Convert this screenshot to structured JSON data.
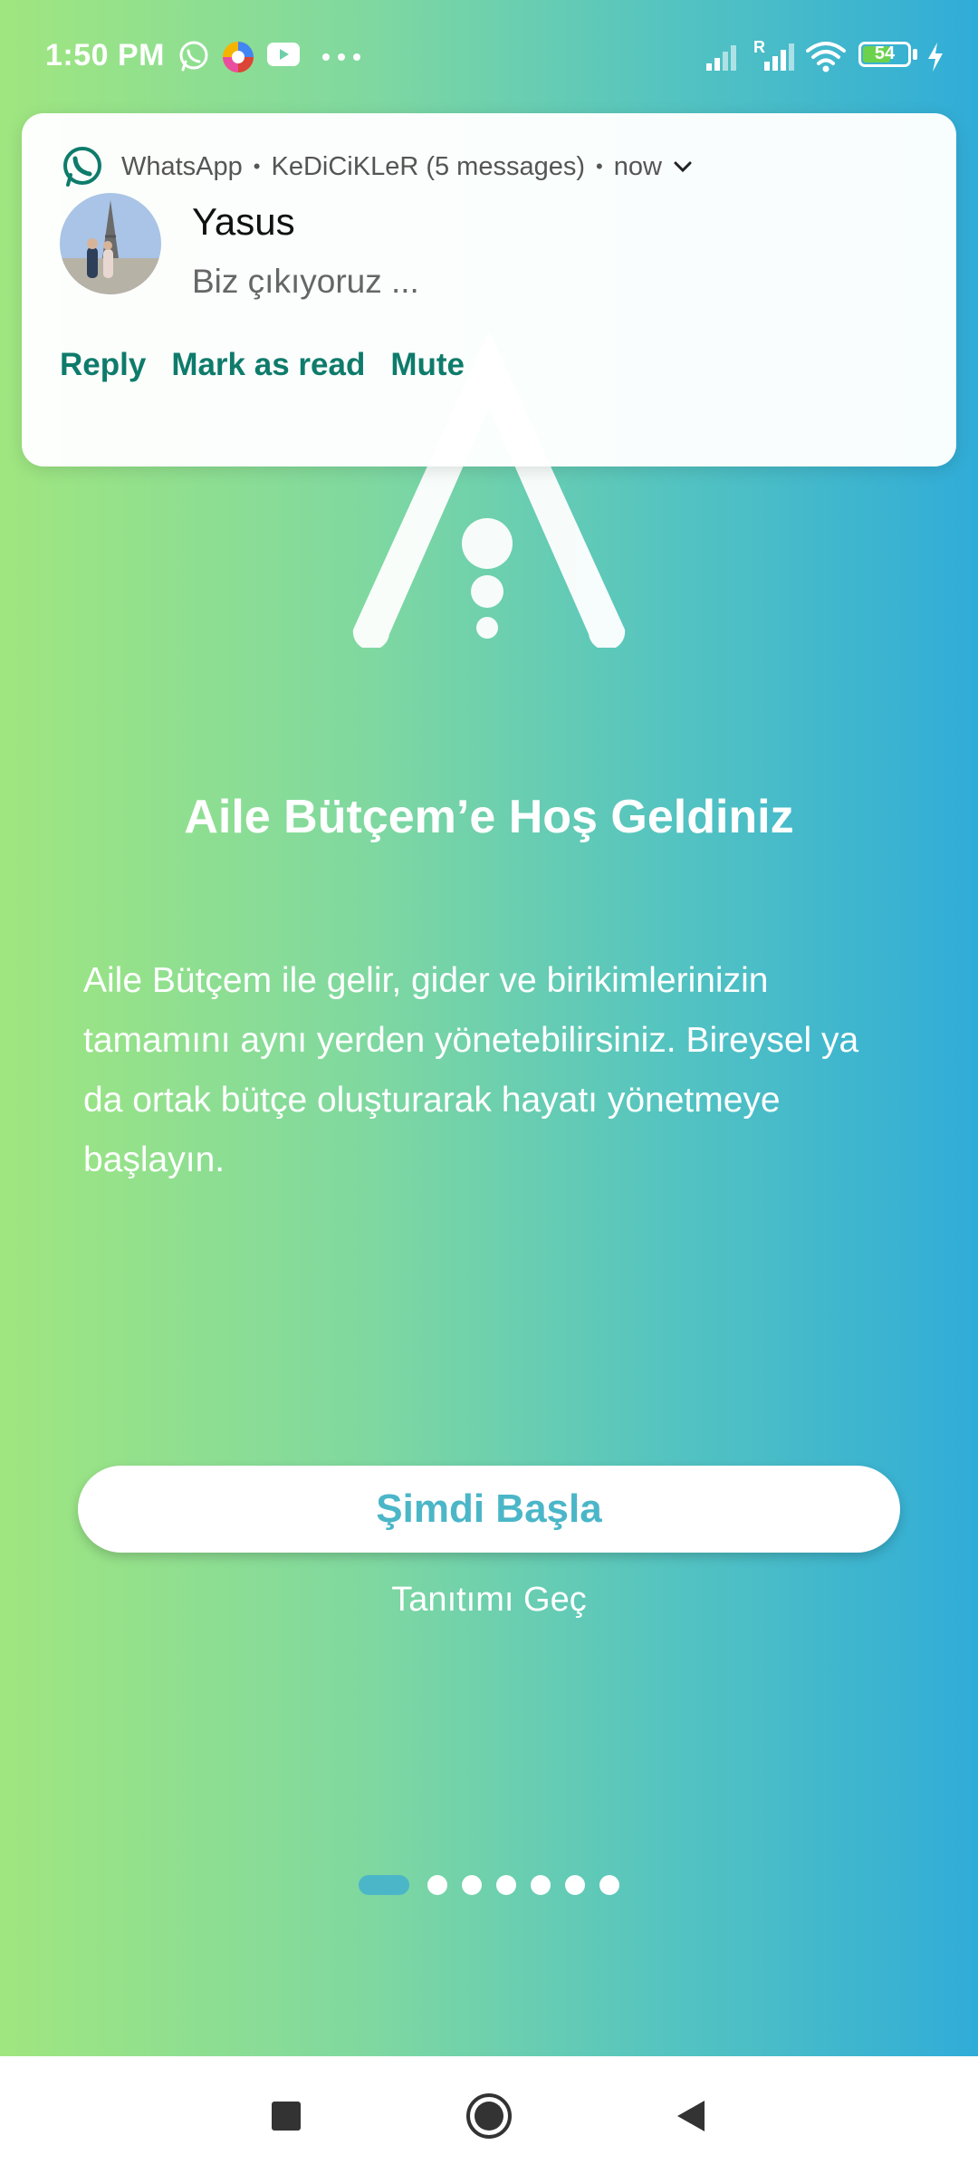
{
  "status_bar": {
    "time": "1:50 PM",
    "battery": "54",
    "roaming": "R",
    "left_icons": [
      "whatsapp-icon",
      "browser-icon",
      "youtube-icon",
      "more-dots-icon"
    ],
    "right_icons": [
      "signal-icon",
      "signal-roaming-icon",
      "wifi-icon",
      "battery-icon",
      "charging-icon"
    ]
  },
  "notification": {
    "app": "WhatsApp",
    "group": "KeDiCiKLeR (5 messages)",
    "time": "now",
    "sender": "Yasus",
    "message": "Biz çıkıyoruz ...",
    "actions": {
      "reply": "Reply",
      "mark_read": "Mark as read",
      "mute": "Mute"
    }
  },
  "onboarding": {
    "title": "Aile Bütçem’e Hoş Geldiniz",
    "description": "Aile Bütçem ile gelir, gider ve birikimlerinizin tamamını aynı yerden yönetebilirsiniz. Bireysel ya da ortak bütçe oluşturarak hayatı yönetmeye başlayın.",
    "start_button": "Şimdi Başla",
    "skip_link": "Tanıtımı Geç",
    "page_count": 7,
    "current_page": 1
  },
  "colors": {
    "gradient_left": "#a0e680",
    "gradient_right": "#30acd8",
    "accent": "#4bb6c8",
    "whatsapp_green": "#0e7b6b"
  },
  "nav_bar": {
    "icons": [
      "recents-square-icon",
      "home-circle-icon",
      "back-triangle-icon"
    ]
  }
}
